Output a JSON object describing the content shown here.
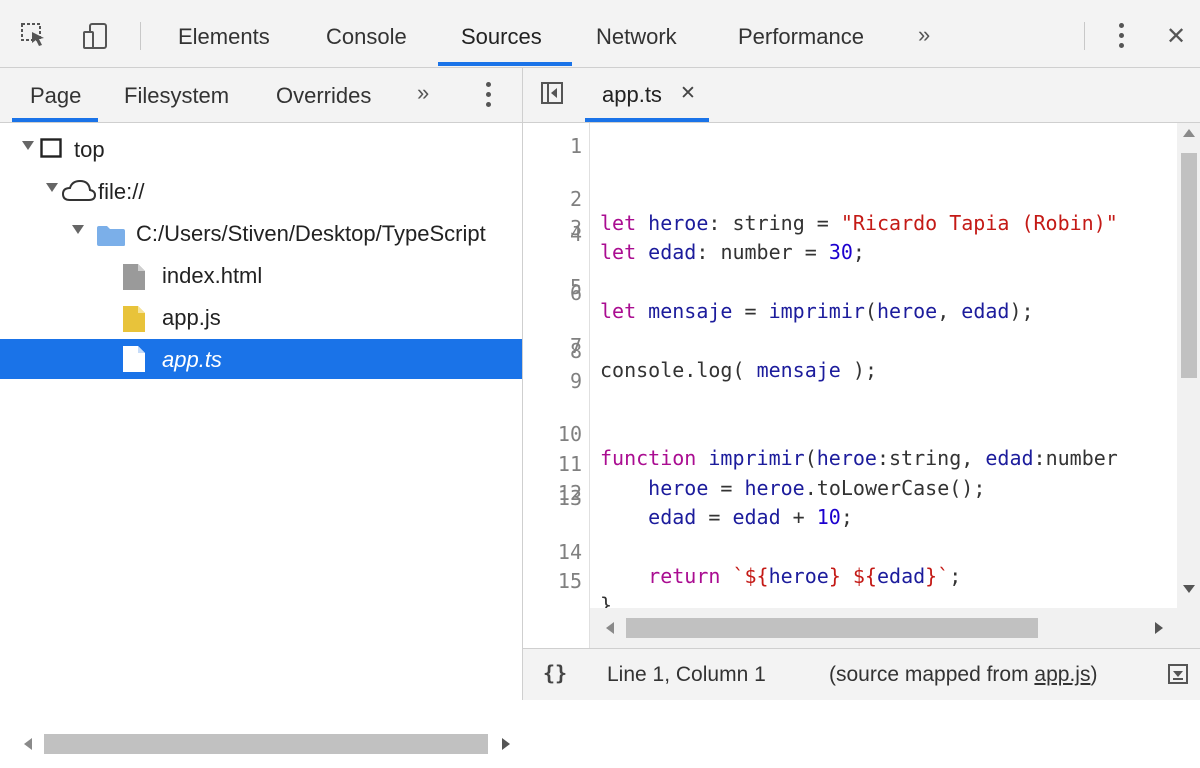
{
  "toolbar": {
    "tabs": [
      "Elements",
      "Console",
      "Sources",
      "Network",
      "Performance"
    ],
    "more_glyph": "»",
    "close_glyph": "✕",
    "active_tab": "Sources",
    "icons": [
      "inspect-element-icon",
      "device-toolbar-icon",
      "more-tabs-icon",
      "kebab-menu-icon",
      "close-icon"
    ]
  },
  "navigator": {
    "tabs": [
      "Page",
      "Filesystem",
      "Overrides"
    ],
    "more_glyph": "»",
    "active_tab": "Page",
    "tree": [
      {
        "label": "top",
        "icon": "frame-icon"
      },
      {
        "label": "file://",
        "icon": "cloud-icon"
      },
      {
        "label": "C:/Users/Stiven/Desktop/TypeScript",
        "icon": "folder-icon"
      },
      {
        "label": "index.html",
        "icon": "file-icon"
      },
      {
        "label": "app.js",
        "icon": "js-file-icon"
      },
      {
        "label": "app.ts",
        "icon": "ts-file-icon",
        "selected": true
      }
    ]
  },
  "editor": {
    "tab_label": "app.ts",
    "tab_close": "✕",
    "lines": [
      {
        "n": "1",
        "code": ""
      },
      {
        "n": "2",
        "code": "let heroe: string = \"Ricardo Tapia (Robin)\""
      },
      {
        "n": "3",
        "code": "let edad: number = 30;"
      },
      {
        "n": "4",
        "code": ""
      },
      {
        "n": "5",
        "code": "let mensaje = imprimir(heroe, edad);"
      },
      {
        "n": "6",
        "code": ""
      },
      {
        "n": "7",
        "code": "console.log( mensaje );"
      },
      {
        "n": "8",
        "code": ""
      },
      {
        "n": "9",
        "code": ""
      },
      {
        "n": "10",
        "code": "function imprimir(heroe:string, edad:number"
      },
      {
        "n": "11",
        "code": "    heroe = heroe.toLowerCase();"
      },
      {
        "n": "12",
        "code": "    edad = edad + 10;"
      },
      {
        "n": "13",
        "code": ""
      },
      {
        "n": "14",
        "code": "    return `${heroe} ${edad}`;"
      },
      {
        "n": "15",
        "code": "}"
      }
    ]
  },
  "status": {
    "pretty_print": "{}",
    "position": "Line 1, Column 1",
    "source_map_prefix": "(source mapped from ",
    "source_map_link": "app.js",
    "source_map_suffix": ")"
  },
  "colors": {
    "accent": "#1a73e8",
    "keyword": "#aa0d91",
    "string": "#c41a16",
    "number": "#1c00cf"
  }
}
